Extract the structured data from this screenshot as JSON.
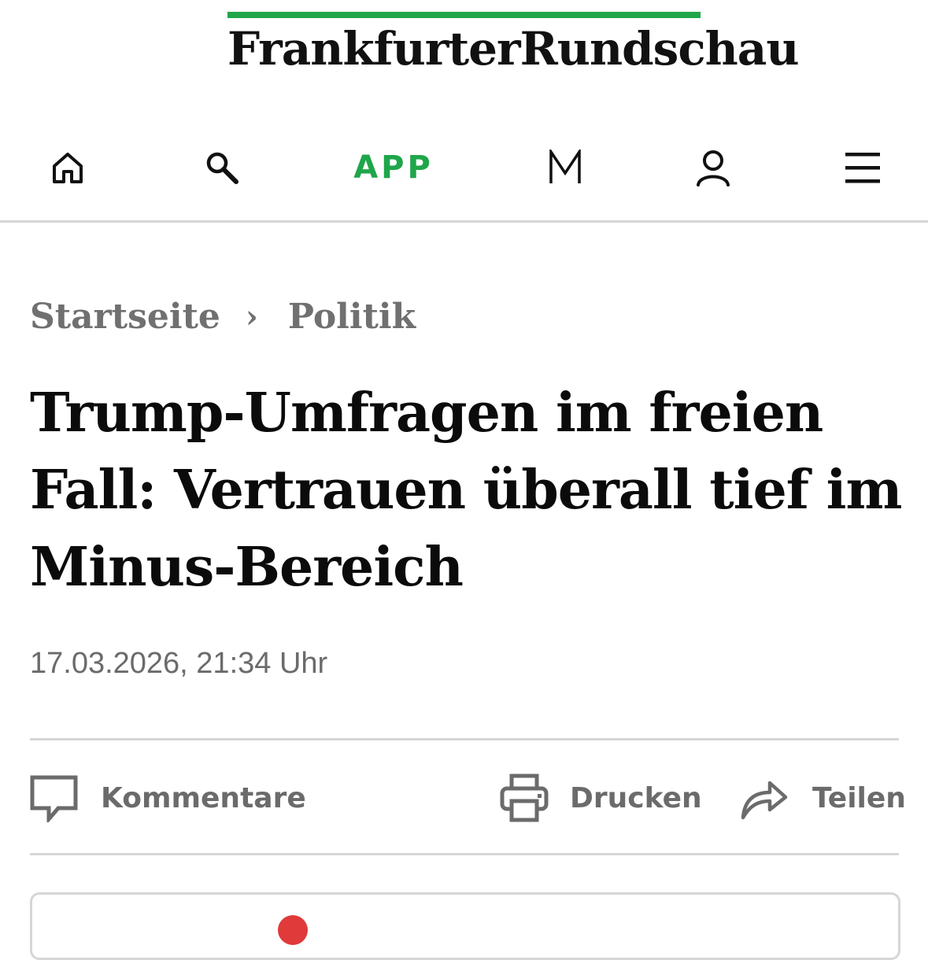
{
  "colors": {
    "brand_green": "#1fa64a",
    "text_dark": "#111111",
    "text_gray": "#6b6b6b",
    "divider": "#d6d6d6",
    "notification_red": "#e03a3a"
  },
  "masthead": {
    "logo_text": "FrankfurterRundschau"
  },
  "nav": {
    "items": [
      {
        "icon": "home-icon"
      },
      {
        "icon": "search-icon"
      },
      {
        "label": "APP"
      },
      {
        "icon": "m-logo-icon"
      },
      {
        "icon": "user-icon"
      },
      {
        "icon": "menu-icon"
      }
    ]
  },
  "breadcrumb": {
    "items": [
      "Startseite",
      "Politik"
    ],
    "separator": "›"
  },
  "article": {
    "headline": "Trump-Umfragen im freien Fall: Vertrauen überall tief im Minus-Bereich",
    "date": "17.03.2026, 21:34 Uhr"
  },
  "actions": {
    "comments_label": "Kommentare",
    "print_label": "Drucken",
    "share_label": "Teilen"
  }
}
